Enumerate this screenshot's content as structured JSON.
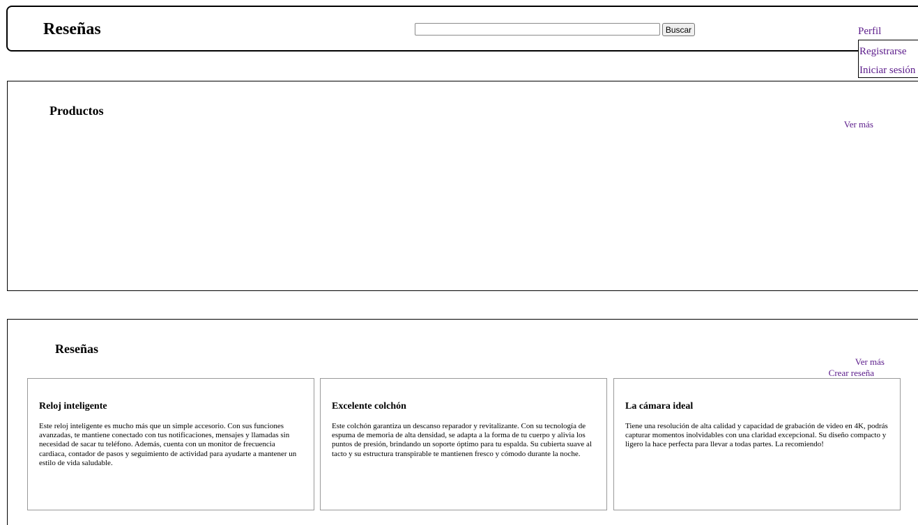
{
  "header": {
    "brand": "Reseñas",
    "search": {
      "value": "",
      "placeholder": "",
      "button_label": "Buscar"
    }
  },
  "nav": {
    "profile": "Perfil",
    "register": "Registrarse",
    "login": "Iniciar sesión"
  },
  "products": {
    "title": "Productos",
    "more_link": "Ver más"
  },
  "reviews": {
    "title": "Reseñas",
    "more_link": "Ver más",
    "create_link": "Crear reseña",
    "cards": [
      {
        "title": "Reloj inteligente",
        "text": "Este reloj inteligente es mucho más que un simple accesorio. Con sus funciones avanzadas, te mantiene conectado con tus notificaciones, mensajes y llamadas sin necesidad de sacar tu teléfono. Además, cuenta con un monitor de frecuencia cardiaca, contador de pasos y seguimiento de actividad para ayudarte a mantener un estilo de vida saludable."
      },
      {
        "title": "Excelente colchón",
        "text": "Este colchón garantiza un descanso reparador y revitalizante. Con su tecnología de espuma de memoria de alta densidad, se adapta a la forma de tu cuerpo y alivia los puntos de presión, brindando un soporte óptimo para tu espalda. Su cubierta suave al tacto y su estructura transpirable te mantienen fresco y cómodo durante la noche."
      },
      {
        "title": "La cámara ideal",
        "text": "Tiene una resolución de alta calidad y capacidad de grabación de video en 4K, podrás capturar momentos inolvidables con una claridad excepcional. Su diseño compacto y ligero la hace perfecta para llevar a todas partes. La recomiendo!"
      }
    ]
  },
  "colors": {
    "link": "#5a1a8a",
    "border": "#000000",
    "card_border": "#999999"
  }
}
